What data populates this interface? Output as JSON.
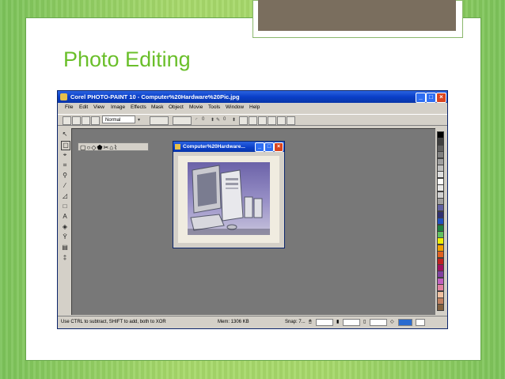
{
  "slide": {
    "title": "Photo Editing"
  },
  "app": {
    "title": "Corel PHOTO-PAINT 10 - Computer%20Hardware%20Pic.jpg",
    "menu": [
      "File",
      "Edit",
      "View",
      "Image",
      "Effects",
      "Mask",
      "Object",
      "Movie",
      "Tools",
      "Window",
      "Help"
    ],
    "toolbar": {
      "merge_mode": "Normal",
      "value_a": "0",
      "value_b": "0",
      "value_c": "0"
    },
    "document": {
      "title": "Computer%20Hardware..."
    },
    "status": {
      "hint": "Use CTRL to subtract, SHIFT to add, both to XOR",
      "memory": "Mem: 1306 KB",
      "snap": "Snap: 7..."
    },
    "palette_colors": [
      "#000000",
      "#3f3f3f",
      "#5f5f5f",
      "#7f7f7f",
      "#9f9f9f",
      "#bfbfbf",
      "#dfdfdf",
      "#ffffff",
      "#e8e8e8",
      "#d0d0d0",
      "#a0a0a0",
      "#6060a0",
      "#303070",
      "#2050c0",
      "#208040",
      "#60c060",
      "#f0f000",
      "#f0a000",
      "#e06020",
      "#c02020",
      "#a01060",
      "#8040a0",
      "#c060c0",
      "#e080a0",
      "#f0c0a0",
      "#c08060",
      "#806040"
    ],
    "accent": "#0a3ec8"
  }
}
